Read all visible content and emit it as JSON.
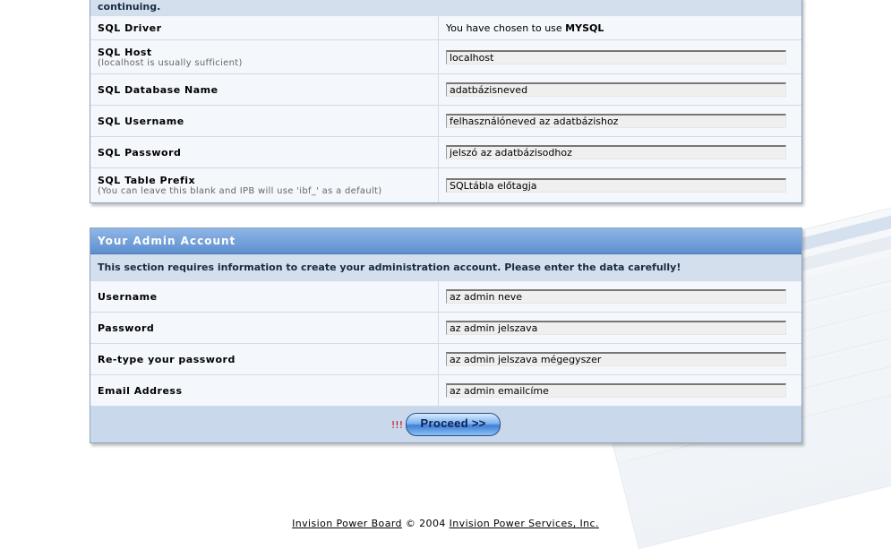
{
  "db_section": {
    "intro_tail": "continuing.",
    "driver_label": "SQL Driver",
    "driver_text_prefix": "You have chosen to use ",
    "driver_value": "MYSQL",
    "host_label": "SQL Host",
    "host_hint": "(localhost is usually sufficient)",
    "host_value": "localhost",
    "dbname_label": "SQL Database Name",
    "dbname_value": "adatbázisneved",
    "user_label": "SQL Username",
    "user_value": "felhasználóneved az adatbázishoz",
    "pass_label": "SQL Password",
    "pass_value": "jelszó az adatbázisodhoz",
    "prefix_label": "SQL Table Prefix",
    "prefix_hint": "(You can leave this blank and IPB will use 'ibf_' as a default)",
    "prefix_value": "SQLtábla előtagja"
  },
  "admin_section": {
    "title": "Your Admin Account",
    "intro": "This section requires information to create your administration account. Please enter the data carefully!",
    "username_label": "Username",
    "username_value": "az admin neve",
    "password_label": "Password",
    "password_value": "az admin jelszava",
    "retype_label": "Re-type your password",
    "retype_value": "az admin jelszava mégegyszer",
    "email_label": "Email Address",
    "email_value": "az admin emailcíme"
  },
  "submit": {
    "warning": "!!!",
    "button_label": "Proceed >>"
  },
  "footer": {
    "product_link": "Invision Power Board",
    "copyright": " © 2004 ",
    "company_link": "Invision Power Services, Inc."
  },
  "colors": {
    "header_blue": "#5d8fcf",
    "row_bg": "#f4f7fb",
    "intro_bg": "#d3dfec",
    "warning_red": "#d00000"
  }
}
